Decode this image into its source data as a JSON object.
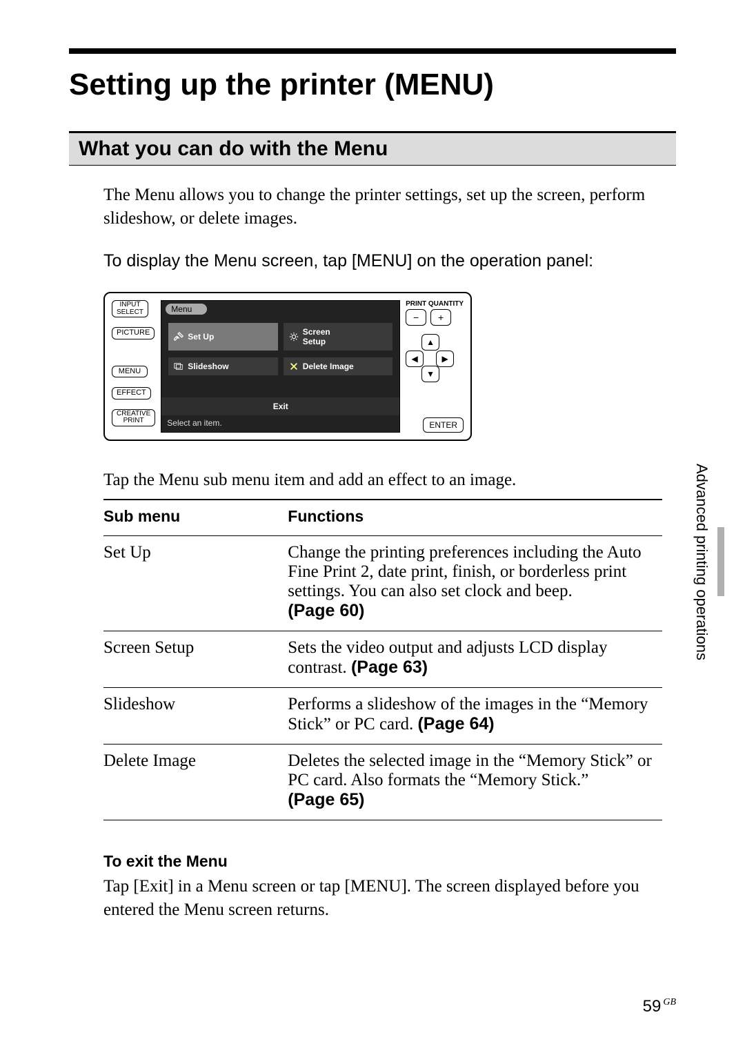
{
  "title": "Setting up the printer (MENU)",
  "section_heading": "What you can do with the Menu",
  "intro": "The Menu allows you to change the printer settings, set up the screen, perform slideshow, or delete images.",
  "instruction": "To display the Menu screen, tap [MENU] on the operation panel:",
  "panel": {
    "left_buttons": [
      "INPUT\nSELECT",
      "PICTURE",
      "MENU",
      "EFFECT",
      "CREATIVE\nPRINT"
    ],
    "screen": {
      "header": "Menu",
      "tiles": [
        {
          "icon": "tools-icon",
          "label": "Set Up",
          "active": true
        },
        {
          "icon": "sun-icon",
          "label": "Screen\nSetup",
          "active": false
        },
        {
          "icon": "slideshow-icon",
          "label": "Slideshow",
          "active": false
        },
        {
          "icon": "x-icon",
          "label": "Delete Image",
          "active": false
        }
      ],
      "exit_label": "Exit",
      "status": "Select an item."
    },
    "right": {
      "print_quantity_label": "PRINT QUANTITY",
      "minus": "−",
      "plus": "+",
      "dpad": {
        "up": "▲",
        "down": "▼",
        "left": "◀",
        "right": "▶"
      },
      "enter": "ENTER"
    }
  },
  "after_panel": "Tap the Menu sub menu item and add an effect to an image.",
  "table": {
    "headers": [
      "Sub menu",
      "Functions"
    ],
    "rows": [
      {
        "sub": "Set Up",
        "func": "Change the printing preferences including the Auto Fine Print 2, date print, finish, or borderless print settings.  You can also set clock and beep.",
        "page": "(Page 60)"
      },
      {
        "sub": "Screen Setup",
        "func": "Sets the video output and adjusts LCD display contrast.",
        "page": "(Page 63)"
      },
      {
        "sub": "Slideshow",
        "func": "Performs a slideshow of the images in the “Memory Stick” or PC card.",
        "page": "(Page 64)"
      },
      {
        "sub": "Delete Image",
        "func": "Deletes the selected image in the “Memory Stick” or PC card.  Also formats the “Memory Stick.”",
        "page": "(Page 65)"
      }
    ]
  },
  "exit": {
    "heading": "To exit the Menu",
    "text": "Tap [Exit] in a Menu screen or tap [MENU].  The screen displayed before you entered the Menu screen returns."
  },
  "side_tab": "Advanced printing operations",
  "page_number": "59",
  "page_lang": "GB"
}
